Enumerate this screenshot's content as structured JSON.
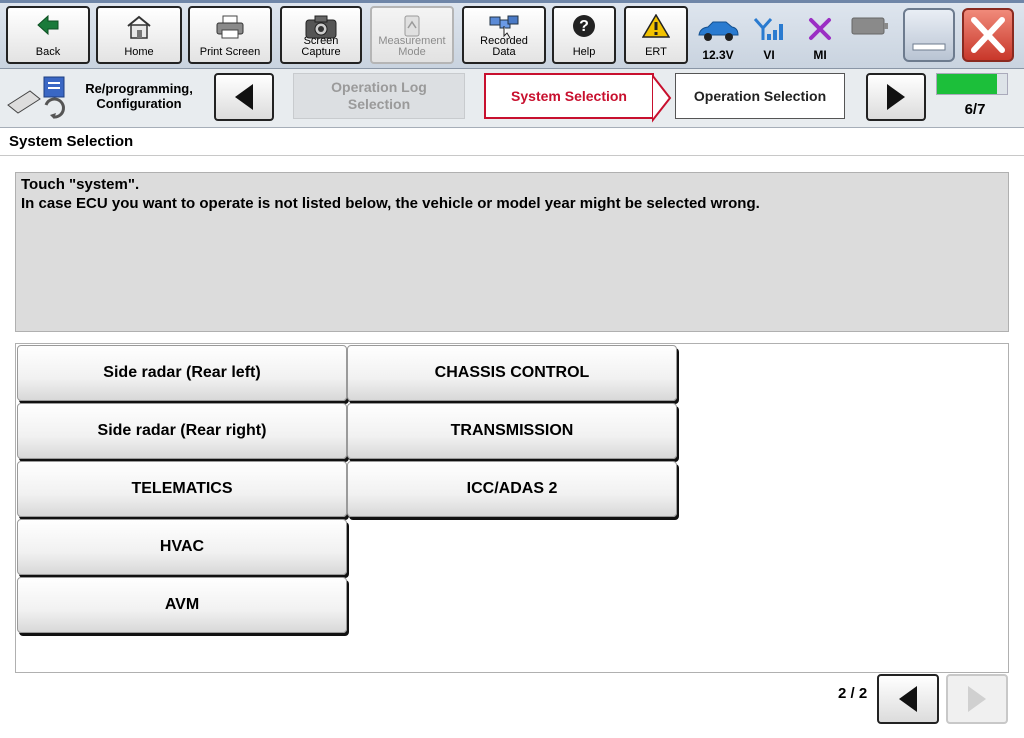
{
  "toolbar": {
    "back": "Back",
    "home": "Home",
    "print_screen": "Print Screen",
    "screen_capture": "Screen Capture",
    "measurement_mode": "Measurement Mode",
    "recorded_data": "Recorded Data",
    "help": "Help",
    "ert": "ERT",
    "voltage": "12.3V",
    "vi": "VI",
    "mi": "MI"
  },
  "breadcrumb": {
    "reprogramming": "Re/programming, Configuration",
    "operation_log": "Operation Log Selection",
    "system_selection": "System Selection",
    "operation_selection": "Operation Selection",
    "step": "6/7",
    "progress": 0.857
  },
  "page": {
    "title": "System Selection",
    "message_line1": "Touch \"system\".",
    "message_line2": "In case ECU you want to operate is not listed below, the vehicle or model year might be selected wrong."
  },
  "systems": {
    "col1": [
      "Side radar (Rear left)",
      "Side radar (Rear right)",
      "TELEMATICS",
      "HVAC",
      "AVM"
    ],
    "col2": [
      "CHASSIS CONTROL",
      "TRANSMISSION",
      "ICC/ADAS 2"
    ]
  },
  "pager": {
    "page": "2 / 2"
  },
  "colors": {
    "accent": "#c8102e",
    "progress": "#1cbf3a"
  }
}
